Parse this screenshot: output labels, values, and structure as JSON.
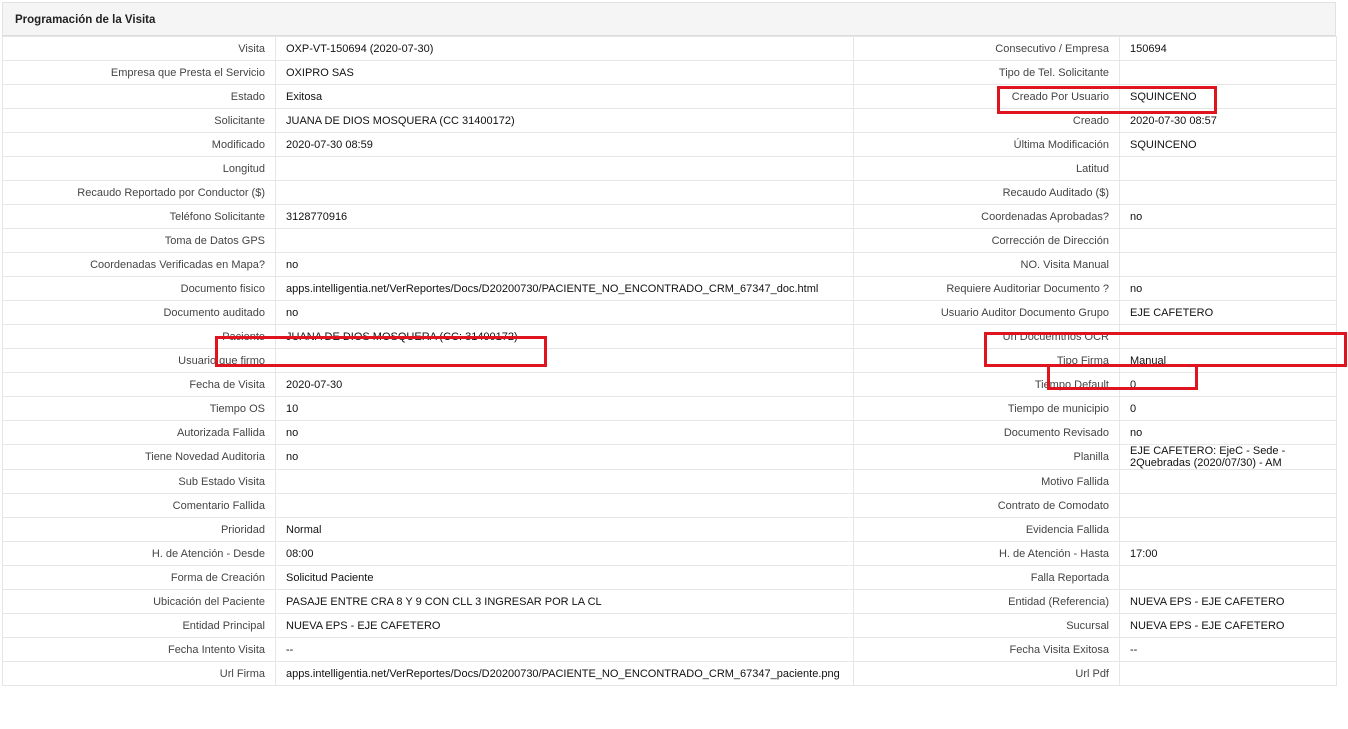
{
  "panel": {
    "title": "Programación de la Visita"
  },
  "colors": {
    "highlight": "#e0141e",
    "header_bg": "#f5f5f5",
    "border": "#e6e6e6"
  },
  "rows": [
    {
      "left_label": "Visita",
      "left_value": "OXP-VT-150694 (2020-07-30)",
      "right_label": "Consecutivo / Empresa",
      "right_value": "150694"
    },
    {
      "left_label": "Empresa que Presta el Servicio",
      "left_value": "OXIPRO SAS",
      "right_label": "Tipo de Tel. Solicitante",
      "right_value": ""
    },
    {
      "left_label": "Estado",
      "left_value": "Exitosa",
      "right_label": "Creado Por Usuario",
      "right_value": "SQUINCENO"
    },
    {
      "left_label": "Solicitante",
      "left_value": "JUANA DE DIOS MOSQUERA (CC 31400172)",
      "right_label": "Creado",
      "right_value": "2020-07-30 08:57"
    },
    {
      "left_label": "Modificado",
      "left_value": "2020-07-30 08:59",
      "right_label": "Última Modificación",
      "right_value": "SQUINCENO"
    },
    {
      "left_label": "Longitud",
      "left_value": "",
      "right_label": "Latitud",
      "right_value": ""
    },
    {
      "left_label": "Recaudo Reportado por Conductor ($)",
      "left_value": "",
      "right_label": "Recaudo Auditado ($)",
      "right_value": ""
    },
    {
      "left_label": "Teléfono Solicitante",
      "left_value": "3128770916",
      "right_label": "Coordenadas Aprobadas?",
      "right_value": "no"
    },
    {
      "left_label": "Toma de Datos GPS",
      "left_value": "",
      "right_label": "Corrección de Dirección",
      "right_value": ""
    },
    {
      "left_label": "Coordenadas Verificadas en Mapa?",
      "left_value": "no",
      "right_label": "NO. Visita Manual",
      "right_value": ""
    },
    {
      "left_label": "Documento fisico",
      "left_value": "apps.intelligentia.net/VerReportes/Docs/D20200730/PACIENTE_NO_ENCONTRADO_CRM_67347_doc.html",
      "right_label": "Requiere Auditoriar Documento ?",
      "right_value": "no"
    },
    {
      "left_label": "Documento auditado",
      "left_value": "no",
      "right_label": "Usuario Auditor Documento Grupo",
      "right_value": "EJE CAFETERO"
    },
    {
      "left_label": "Paciente",
      "left_value": "JUANA DE DIOS MOSQUERA (CC: 31400172)",
      "right_label": "Url Docuemtnos OCR",
      "right_value": ""
    },
    {
      "left_label": "Usuario que firmo",
      "left_value": "",
      "right_label": "Tipo Firma",
      "right_value": "Manual"
    },
    {
      "left_label": "Fecha de Visita",
      "left_value": "2020-07-30",
      "right_label": "Tiempo Default",
      "right_value": "0"
    },
    {
      "left_label": "Tiempo OS",
      "left_value": "10",
      "right_label": "Tiempo de municipio",
      "right_value": "0"
    },
    {
      "left_label": "Autorizada Fallida",
      "left_value": "no",
      "right_label": "Documento Revisado",
      "right_value": "no"
    },
    {
      "left_label": "Tiene Novedad Auditoria",
      "left_value": "no",
      "right_label": "Planilla",
      "right_value": "EJE CAFETERO: EjeC - Sede - 2Quebradas (2020/07/30) - AM"
    },
    {
      "left_label": "Sub Estado Visita",
      "left_value": "",
      "right_label": "Motivo Fallida",
      "right_value": ""
    },
    {
      "left_label": "Comentario Fallida",
      "left_value": "",
      "right_label": "Contrato de Comodato",
      "right_value": ""
    },
    {
      "left_label": "Prioridad",
      "left_value": "Normal",
      "right_label": "Evidencia Fallida",
      "right_value": ""
    },
    {
      "left_label": "H. de Atención - Desde",
      "left_value": "08:00",
      "right_label": "H. de Atención - Hasta",
      "right_value": "17:00"
    },
    {
      "left_label": "Forma de Creación",
      "left_value": "Solicitud Paciente",
      "right_label": "Falla Reportada",
      "right_value": ""
    },
    {
      "left_label": "Ubicación del Paciente",
      "left_value": "PASAJE ENTRE CRA 8 Y 9 CON CLL 3 INGRESAR POR LA CL",
      "right_label": "Entidad (Referencia)",
      "right_value": "NUEVA EPS - EJE CAFETERO"
    },
    {
      "left_label": "Entidad Principal",
      "left_value": "NUEVA EPS - EJE CAFETERO",
      "right_label": "Sucursal",
      "right_value": "NUEVA EPS - EJE CAFETERO"
    },
    {
      "left_label": "Fecha Intento Visita",
      "left_value": "--",
      "right_label": "Fecha Visita Exitosa",
      "right_value": "--"
    },
    {
      "left_label": "Url Firma",
      "left_value": "apps.intelligentia.net/VerReportes/Docs/D20200730/PACIENTE_NO_ENCONTRADO_CRM_67347_paciente.png",
      "right_label": "Url Pdf",
      "right_value": ""
    }
  ]
}
